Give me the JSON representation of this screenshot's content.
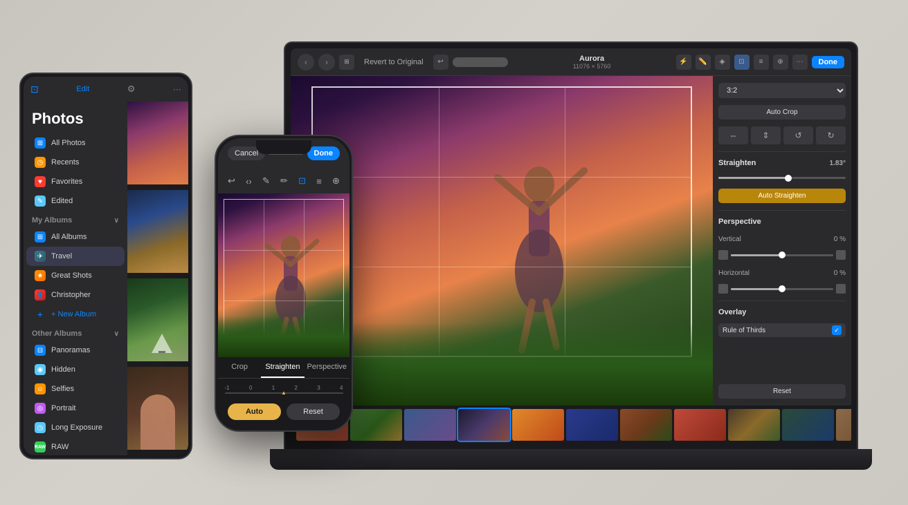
{
  "app": {
    "title": "Photos"
  },
  "macbook": {
    "toolbar": {
      "back_label": "‹",
      "forward_label": "›",
      "photo_title": "Aurora",
      "photo_dimensions": "11076 × 5760",
      "revert_label": "Revert to Original",
      "done_label": "Done"
    },
    "right_panel": {
      "aspect_ratio": "3:2",
      "auto_crop_label": "Auto Crop",
      "straighten_label": "Straighten",
      "straighten_value": "1.83°",
      "auto_straighten_label": "Auto Straighten",
      "perspective_label": "Perspective",
      "vertical_label": "Vertical",
      "vertical_value": "0 %",
      "horizontal_label": "Horizontal",
      "horizontal_value": "0 %",
      "overlay_label": "Overlay",
      "overlay_value": "Rule of Thirds",
      "reset_label": "Reset"
    },
    "filmstrip": {
      "count": 11
    }
  },
  "ipad": {
    "header": {
      "edit_label": "Edit",
      "more_label": "···"
    },
    "sidebar": {
      "title": "Photos",
      "items": [
        {
          "label": "All Photos",
          "icon": "grid"
        },
        {
          "label": "Recents",
          "icon": "clock"
        },
        {
          "label": "Favorites",
          "icon": "heart"
        },
        {
          "label": "Edited",
          "icon": "pencil"
        }
      ],
      "my_albums_title": "My Albums",
      "my_albums": [
        {
          "label": "All Albums",
          "icon": "grid"
        },
        {
          "label": "Travel",
          "icon": "airplane",
          "active": true
        },
        {
          "label": "Great Shots",
          "icon": "star"
        },
        {
          "label": "Christopher",
          "icon": "person"
        }
      ],
      "new_album_label": "+ New Album",
      "other_albums_title": "Other Albums",
      "other_albums": [
        {
          "label": "Panoramas",
          "icon": "panorama"
        },
        {
          "label": "Hidden",
          "icon": "eye-slash"
        },
        {
          "label": "Selfies",
          "icon": "person-fill"
        },
        {
          "label": "Portrait",
          "icon": "f-stop"
        },
        {
          "label": "Long Exposure",
          "icon": "timer"
        },
        {
          "label": "RAW",
          "icon": "raw"
        }
      ]
    }
  },
  "iphone": {
    "toolbar": {
      "cancel_label": "Cancel",
      "done_label": "Done"
    },
    "tabs": [
      {
        "label": "Crop",
        "active": false
      },
      {
        "label": "Straighten",
        "active": true
      },
      {
        "label": "Perspective",
        "active": false
      }
    ],
    "buttons": {
      "auto_label": "Auto",
      "reset_label": "Reset"
    }
  }
}
